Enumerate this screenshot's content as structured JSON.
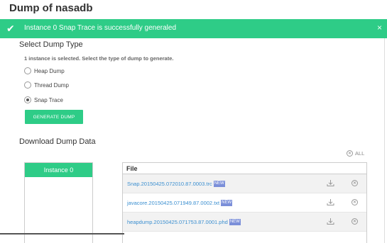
{
  "dialog": {
    "title": "Dump of nasadb"
  },
  "banner": {
    "check_glyph": "✔",
    "message": "Instance 0 Snap Trace is successfully generaled",
    "close_glyph": "×"
  },
  "select": {
    "heading": "Select Dump Type",
    "hint": "1 instance is selected. Select the type of dump to generate.",
    "options": [
      {
        "label": "Heap Dump",
        "checked": false
      },
      {
        "label": "Thread Dump",
        "checked": false
      },
      {
        "label": "Snap Trace",
        "checked": true
      }
    ],
    "generate_label": "GENERATE DUMP"
  },
  "download": {
    "heading": "Download Dump Data",
    "all_label": "ALL",
    "instances": [
      "Instance 0"
    ],
    "file_header": "File",
    "files": [
      {
        "name": "Snap.20150425.072010.87.0003.trc",
        "badge": "NEW"
      },
      {
        "name": "javacore.20150425.071949.87.0002.txt",
        "badge": "NEW"
      },
      {
        "name": "heapdump.20150425.071753.87.0001.phd",
        "badge": "NEW"
      }
    ]
  },
  "colors": {
    "accent": "#2ecc87",
    "link": "#3b8fd0",
    "badge": "#7b8fd9"
  }
}
